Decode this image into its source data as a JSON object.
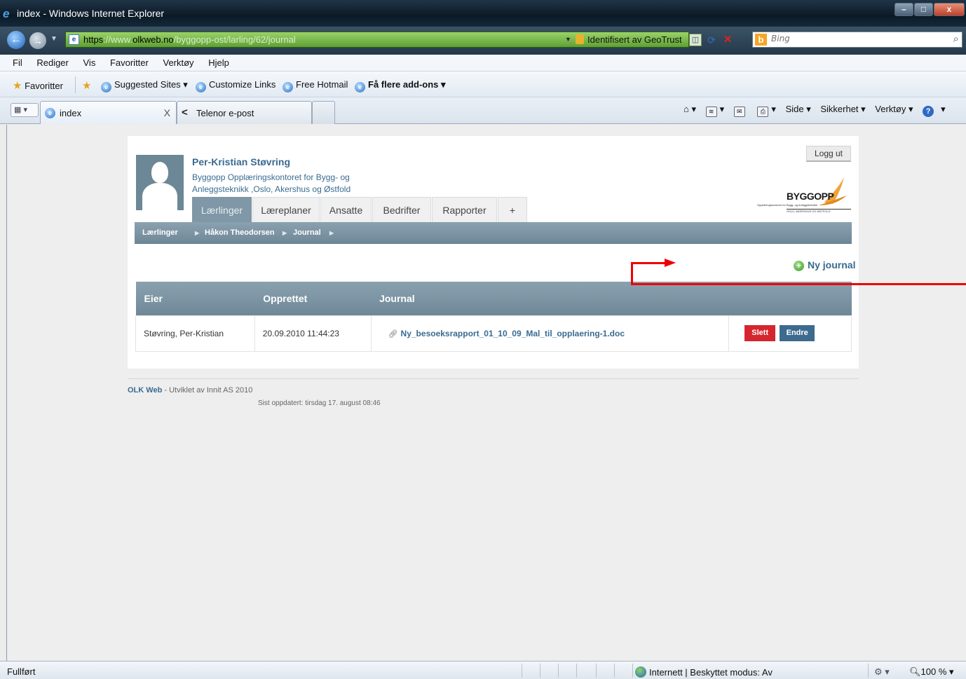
{
  "window": {
    "title": "index - Windows Internet Explorer"
  },
  "address": {
    "url_scheme": "https",
    "url_sep": "://www.",
    "url_host": "olkweb.no",
    "url_path": "/byggopp-ost/larling/62/journal",
    "cert": "Identifisert av GeoTrust"
  },
  "search": {
    "placeholder": "Bing"
  },
  "menu": [
    "Fil",
    "Rediger",
    "Vis",
    "Favoritter",
    "Verktøy",
    "Hjelp"
  ],
  "favorites": {
    "favorites_label": "Favoritter",
    "suggested": "Suggested Sites ▾",
    "customize": "Customize Links",
    "hotmail": "Free Hotmail",
    "addons": "Få flere add-ons ▾"
  },
  "tabs_bar": {
    "tab1": "index",
    "tab2": "Telenor e-post",
    "cmd": {
      "side": "Side ▾",
      "sikkerhet": "Sikkerhet ▾",
      "verktoy": "Verktøy ▾"
    }
  },
  "profile": {
    "name": "Per-Kristian Støvring",
    "org_line1": "Byggopp Opplæringskontoret for Bygg- og",
    "org_line2": "Anleggsteknikk ,Oslo, Akershus og Østfold",
    "logout": "Logg ut"
  },
  "logo": {
    "word": "BYGGOPP",
    "tag1": "Opplæringskontoret for Bygg- og Anleggsteknikk",
    "tag2": "OSLO, AKERSHUS OG ØSTFOLD"
  },
  "nav_tabs": [
    "Lærlinger",
    "Læreplaner",
    "Ansatte",
    "Bedrifter",
    "Rapporter",
    "+"
  ],
  "breadcrumb": [
    "Lærlinger",
    "Håkon Theodorsen",
    "Journal"
  ],
  "new_journal": "Ny journal",
  "table": {
    "headers": [
      "Eier",
      "Opprettet",
      "Journal"
    ],
    "rows": [
      {
        "owner": "Støvring, Per-Kristian",
        "created": "20.09.2010 11:44:23",
        "file": "Ny_besoeksrapport_01_10_09_Mal_til_opplaering-1.doc",
        "delete": "Slett",
        "edit": "Endre"
      }
    ]
  },
  "footer": {
    "brand": "OLK Web",
    "credit": " - Utviklet av Innit AS 2010",
    "updated": "Sist oppdatert: tirsdag 17. august 08:46"
  },
  "status": {
    "left": "Fullført",
    "zone": "Internett | Beskyttet modus: Av",
    "zoom": "100 %"
  },
  "colors": {
    "accent": "#3a6b91",
    "header_gray": "#7f97a6",
    "delete_red": "#d5262e",
    "edit_blue": "#3d6a8f",
    "annotation_red": "#ee0000"
  }
}
